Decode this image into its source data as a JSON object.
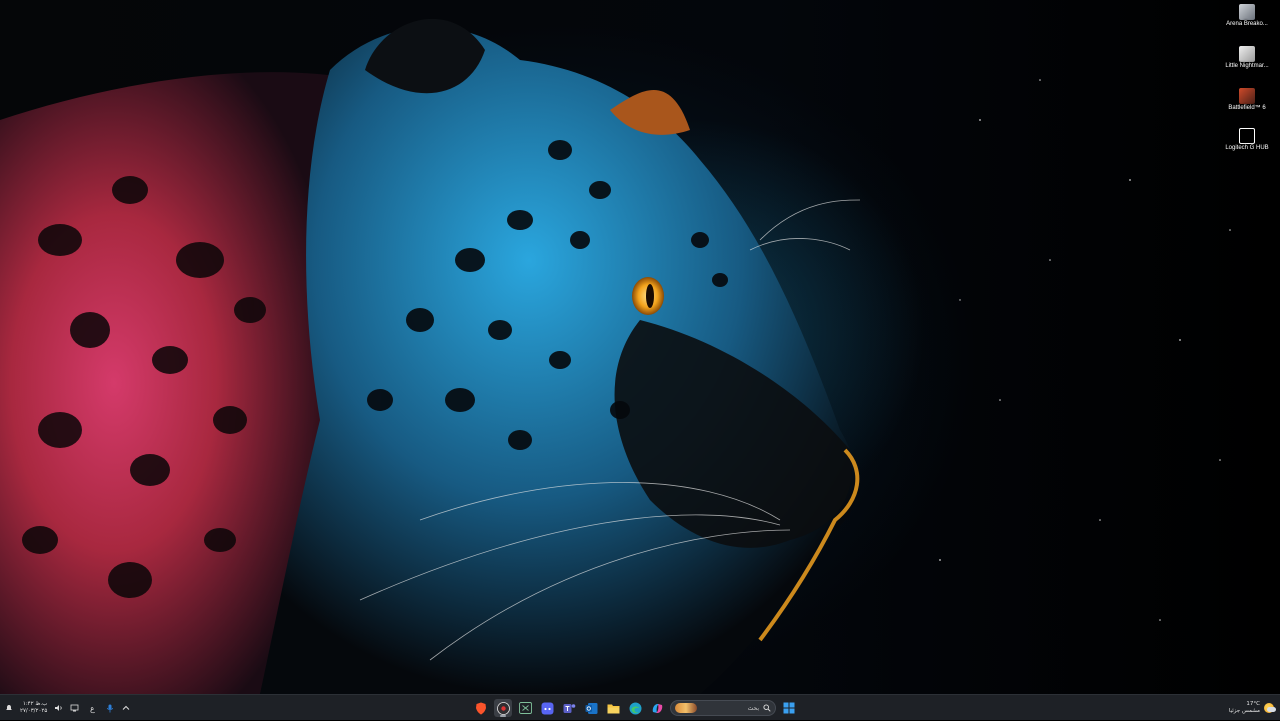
{
  "desktop": {
    "icons": [
      {
        "label": "Arena Breako...",
        "icon": "arena-breakout-game-icon"
      },
      {
        "label": "Little Nightmar...",
        "icon": "little-nightmares-game-icon"
      },
      {
        "label": "Battlefield™ 6",
        "icon": "battlefield-6-game-icon"
      },
      {
        "label": "Logitech G HUB",
        "icon": "logitech-g-hub-icon"
      }
    ]
  },
  "taskbar": {
    "clock": {
      "time": "۱:۴۲ ب.ظ",
      "date": "۲۷/۰۳/۲۰۲۵"
    },
    "search": {
      "placeholder": "بحث"
    },
    "language": "ع",
    "pinned_apps": [
      "brave-browser-icon",
      "obs-studio-icon",
      "excel-icon",
      "discord-icon",
      "teams-icon",
      "outlook-icon",
      "file-explorer-icon",
      "edge-icon",
      "copilot-icon"
    ],
    "weather": {
      "temp": "17°C",
      "condition": "مشمس جزئيا"
    },
    "colors": {
      "taskbar": "#1e2126",
      "accent": "#0078d4"
    }
  }
}
